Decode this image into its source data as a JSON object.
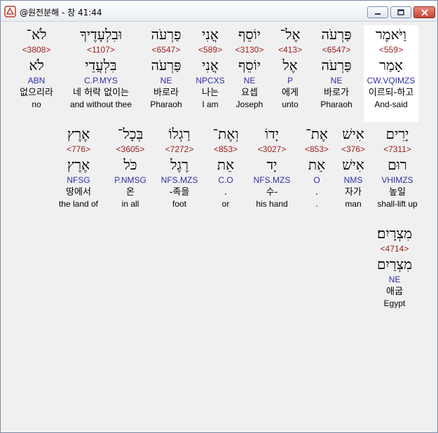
{
  "window": {
    "title": "@원전분해 - 창 41:44",
    "icons": [
      "app-hebrew-icon",
      "minimize-icon",
      "maximize-icon",
      "close-icon"
    ]
  },
  "words": [
    {
      "heb": "וַיֹּאמֶר",
      "strong": "<559>",
      "lemma": "אָמַר",
      "morph": "CW.VQIMZS",
      "kor": "이르되-하고",
      "eng": "And-said"
    },
    {
      "heb": "פַּרְעֹה",
      "strong": "<6547>",
      "lemma": "פַּרְעֹה",
      "morph": "NE",
      "kor": "바로가",
      "eng": "Pharaoh"
    },
    {
      "heb": "אֶל־",
      "strong": "<413>",
      "lemma": "אֶל",
      "morph": "P",
      "kor": "에게",
      "eng": "unto"
    },
    {
      "heb": "יוֹסֵף",
      "strong": "<3130>",
      "lemma": "יוֹסֵף",
      "morph": "NE",
      "kor": "요셉",
      "eng": "Joseph"
    },
    {
      "heb": "אֲנִי",
      "strong": "<589>",
      "lemma": "אֲנִי",
      "morph": "NPCXS",
      "kor": "나는",
      "eng": "I am"
    },
    {
      "heb": "פַרְעֹה",
      "strong": "<6547>",
      "lemma": "פַּרְעֹה",
      "morph": "NE",
      "kor": "바로라",
      "eng": "Pharaoh"
    },
    {
      "heb": "וּבִלְעָדֶיךָ",
      "strong": "<1107>",
      "lemma": "בִּלְעֲדֵי",
      "morph": "C.P.MYS",
      "kor": "네 허락 없이는",
      "eng": "and without thee"
    },
    {
      "heb": "לֹא־",
      "strong": "<3808>",
      "lemma": "לֹא",
      "morph": "ABN",
      "kor": "없으리라",
      "eng": "no"
    },
    {
      "heb": "יָרִים",
      "strong": "<7311>",
      "lemma": "רוּם",
      "morph": "VHIMZS",
      "kor": "높일",
      "eng": "shall-lift up"
    },
    {
      "heb": "אִישׁ",
      "strong": "<376>",
      "lemma": "אִישׁ",
      "morph": "NMS",
      "kor": "자가",
      "eng": "man"
    },
    {
      "heb": "אֶת־",
      "strong": "<853>",
      "lemma": "אֵת",
      "morph": "O",
      "kor": ".",
      "eng": "."
    },
    {
      "heb": "יָדוֹ",
      "strong": "<3027>",
      "lemma": "יָד",
      "morph": "NFS.MZS",
      "kor": "수-",
      "eng": "his hand"
    },
    {
      "heb": "וְאֶת־",
      "strong": "<853>",
      "lemma": "אֵת",
      "morph": "C.O",
      "kor": ".",
      "eng": "or"
    },
    {
      "heb": "רַגְלוֹ",
      "strong": "<7272>",
      "lemma": "רֶגֶל",
      "morph": "NFS.MZS",
      "kor": "-족을",
      "eng": "foot"
    },
    {
      "heb": "בְּכָל־",
      "strong": "<3605>",
      "lemma": "כֹּל",
      "morph": "P.NMSG",
      "kor": "온",
      "eng": "in all"
    },
    {
      "heb": "אֶרֶץ",
      "strong": "<776>",
      "lemma": "אֶרֶץ",
      "morph": "NFSG",
      "kor": "땅에서",
      "eng": "the land of"
    },
    {
      "heb": "מִצְרָיִם׃",
      "strong": "<4714>",
      "lemma": "מִצְרַיִם",
      "morph": "NE",
      "kor": "애굽",
      "eng": "Egypt"
    }
  ]
}
